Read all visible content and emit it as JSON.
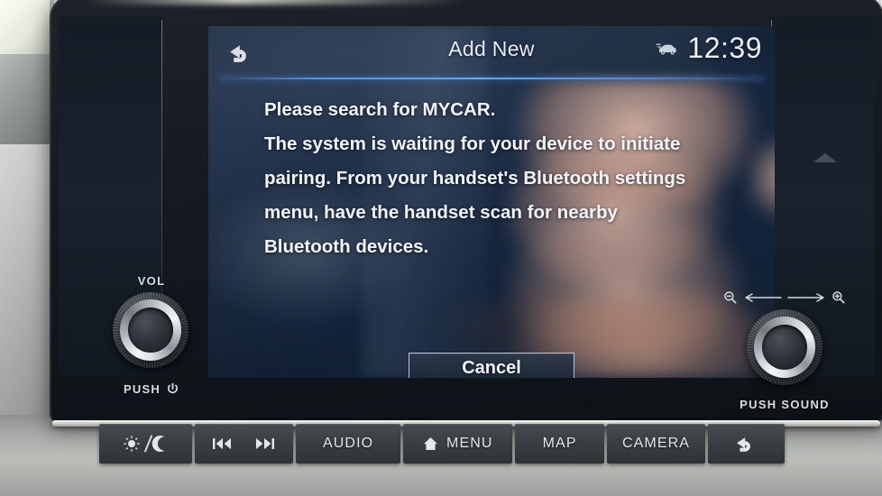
{
  "header": {
    "back_icon": "back-arrow-icon",
    "title": "Add New",
    "car_icon": "car-icon",
    "clock": "12:39"
  },
  "message": {
    "lines": [
      "Please search for MYCAR.",
      "The system is waiting for your device to initiate",
      "pairing. From your handset's Bluetooth settings",
      "menu, have the handset scan for nearby",
      "Bluetooth devices."
    ]
  },
  "actions": {
    "cancel_label": "Cancel"
  },
  "knobs": {
    "left": {
      "top_label": "VOL",
      "bottom_label": "PUSH",
      "power_icon": "power-icon"
    },
    "right": {
      "zoom_out_icon": "zoom-out-icon",
      "zoom_in_icon": "zoom-in-icon",
      "bottom_label": "PUSH SOUND"
    }
  },
  "hardkeys": [
    {
      "name": "brightness",
      "label": "",
      "icon": "sun-moon-icon"
    },
    {
      "name": "track",
      "label": "",
      "icon": "prev-next-track-icon"
    },
    {
      "name": "audio",
      "label": "AUDIO",
      "icon": ""
    },
    {
      "name": "menu",
      "label": "MENU",
      "icon": "home-icon"
    },
    {
      "name": "map",
      "label": "MAP",
      "icon": ""
    },
    {
      "name": "camera",
      "label": "CAMERA",
      "icon": ""
    },
    {
      "name": "back",
      "label": "",
      "icon": "back-arrow-icon"
    }
  ],
  "colors": {
    "screen_bg": "#17263d",
    "accent_rule": "#5aa0ff",
    "text": "#f2f5f9",
    "key_face": "#3a3f43"
  }
}
